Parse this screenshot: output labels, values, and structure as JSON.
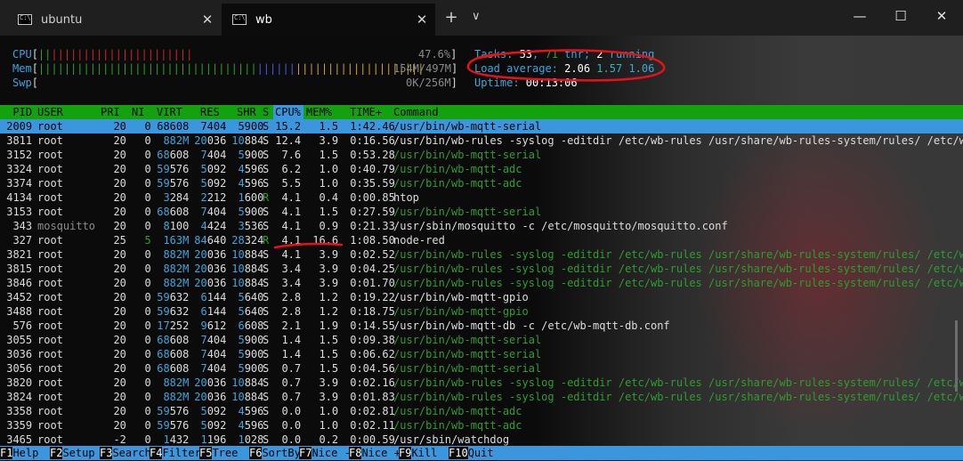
{
  "tabs": [
    {
      "label": "ubuntu",
      "active": false
    },
    {
      "label": "wb",
      "active": true
    }
  ],
  "window": {
    "new_tab": "+",
    "dropdown": "∨",
    "minimize": "—",
    "maximize": "☐",
    "close": "✕",
    "tab_close": "✕"
  },
  "meters": {
    "cpu": {
      "label": "CPU",
      "bar_green": "||",
      "bar_blue": "",
      "bar_red": "||||||||||||||||||||||",
      "bar_rest": "",
      "value": "47.6%"
    },
    "mem": {
      "label": "Mem",
      "bar_green": "||||||||||||||||||||||||||||||||||",
      "bar_blue": "||||||",
      "bar_yellow": "||||||||||||||||||||",
      "value": "154M/497M"
    },
    "swp": {
      "label": "Swp",
      "value": "0K/256M"
    }
  },
  "stats": {
    "tasks_label": "Tasks: ",
    "tasks": "53",
    "thr": "71",
    "thr_label": " thr; ",
    "running": "2",
    "running_label": " running",
    "load_label": "Load average: ",
    "load1": "2.06",
    "load5": "1.57",
    "load15": "1.06",
    "uptime_label": "Uptime: ",
    "uptime": "00:13:06"
  },
  "columns": {
    "pid": "PID",
    "user": "USER",
    "pri": "PRI",
    "ni": "NI",
    "virt": "VIRT",
    "res": "RES",
    "shr": "SHR",
    "s": "S",
    "cpu": "CPU%",
    "mem": "MEM%",
    "time": "TIME+",
    "command": "Command"
  },
  "processes": [
    {
      "pid": "2009",
      "user": "root",
      "pri": "20",
      "ni": "0",
      "virt": "68608",
      "res": "7404",
      "shr": "5900",
      "s": "S",
      "cpu": "15.2",
      "mem": "1.5",
      "time": "1:42.46",
      "cmd": "/usr/bin/wb-mqtt-serial",
      "thread": false
    },
    {
      "pid": "3811",
      "user": "root",
      "pri": "20",
      "ni": "0",
      "virt": "882M",
      "res": "20036",
      "shr": "10884",
      "s": "S",
      "cpu": "12.4",
      "mem": "3.9",
      "time": "0:16.56",
      "cmd": "/usr/bin/wb-rules -syslog -editdir /etc/wb-rules /usr/share/wb-rules-system/rules/ /etc/w",
      "thread": false
    },
    {
      "pid": "3152",
      "user": "root",
      "pri": "20",
      "ni": "0",
      "virt": "68608",
      "res": "7404",
      "shr": "5900",
      "s": "S",
      "cpu": "7.6",
      "mem": "1.5",
      "time": "0:53.28",
      "cmd": "/usr/bin/wb-mqtt-serial",
      "thread": true
    },
    {
      "pid": "3324",
      "user": "root",
      "pri": "20",
      "ni": "0",
      "virt": "59576",
      "res": "5092",
      "shr": "4596",
      "s": "S",
      "cpu": "6.2",
      "mem": "1.0",
      "time": "0:40.79",
      "cmd": "/usr/bin/wb-mqtt-adc",
      "thread": true
    },
    {
      "pid": "3374",
      "user": "root",
      "pri": "20",
      "ni": "0",
      "virt": "59576",
      "res": "5092",
      "shr": "4596",
      "s": "S",
      "cpu": "5.5",
      "mem": "1.0",
      "time": "0:35.59",
      "cmd": "/usr/bin/wb-mqtt-adc",
      "thread": true
    },
    {
      "pid": "4134",
      "user": "root",
      "pri": "20",
      "ni": "0",
      "virt": "3284",
      "res": "2212",
      "shr": "1600",
      "s": "R",
      "cpu": "4.1",
      "mem": "0.4",
      "time": "0:00.85",
      "cmd": "htop",
      "thread": false
    },
    {
      "pid": "3153",
      "user": "root",
      "pri": "20",
      "ni": "0",
      "virt": "68608",
      "res": "7404",
      "shr": "5900",
      "s": "S",
      "cpu": "4.1",
      "mem": "1.5",
      "time": "0:27.59",
      "cmd": "/usr/bin/wb-mqtt-serial",
      "thread": true
    },
    {
      "pid": "343",
      "user": "mosquitto",
      "pri": "20",
      "ni": "0",
      "virt": "8100",
      "res": "4424",
      "shr": "3536",
      "s": "S",
      "cpu": "4.1",
      "mem": "0.9",
      "time": "0:21.33",
      "cmd": "/usr/sbin/mosquitto -c /etc/mosquitto/mosquitto.conf",
      "thread": false
    },
    {
      "pid": "327",
      "user": "root",
      "pri": "25",
      "ni": "5",
      "virt": "163M",
      "res": "84640",
      "shr": "28324",
      "s": "R",
      "cpu": "4.1",
      "mem": "16.6",
      "time": "1:08.50",
      "cmd": "node-red",
      "thread": false
    },
    {
      "pid": "3821",
      "user": "root",
      "pri": "20",
      "ni": "0",
      "virt": "882M",
      "res": "20036",
      "shr": "10884",
      "s": "S",
      "cpu": "4.1",
      "mem": "3.9",
      "time": "0:02.52",
      "cmd": "/usr/bin/wb-rules -syslog -editdir /etc/wb-rules /usr/share/wb-rules-system/rules/ /etc/w",
      "thread": true
    },
    {
      "pid": "3815",
      "user": "root",
      "pri": "20",
      "ni": "0",
      "virt": "882M",
      "res": "20036",
      "shr": "10884",
      "s": "S",
      "cpu": "3.4",
      "mem": "3.9",
      "time": "0:04.25",
      "cmd": "/usr/bin/wb-rules -syslog -editdir /etc/wb-rules /usr/share/wb-rules-system/rules/ /etc/w",
      "thread": true
    },
    {
      "pid": "3846",
      "user": "root",
      "pri": "20",
      "ni": "0",
      "virt": "882M",
      "res": "20036",
      "shr": "10884",
      "s": "S",
      "cpu": "3.4",
      "mem": "3.9",
      "time": "0:01.70",
      "cmd": "/usr/bin/wb-rules -syslog -editdir /etc/wb-rules /usr/share/wb-rules-system/rules/ /etc/w",
      "thread": true
    },
    {
      "pid": "3452",
      "user": "root",
      "pri": "20",
      "ni": "0",
      "virt": "59632",
      "res": "6144",
      "shr": "5640",
      "s": "S",
      "cpu": "2.8",
      "mem": "1.2",
      "time": "0:19.22",
      "cmd": "/usr/bin/wb-mqtt-gpio",
      "thread": false
    },
    {
      "pid": "3488",
      "user": "root",
      "pri": "20",
      "ni": "0",
      "virt": "59632",
      "res": "6144",
      "shr": "5640",
      "s": "S",
      "cpu": "2.8",
      "mem": "1.2",
      "time": "0:18.75",
      "cmd": "/usr/bin/wb-mqtt-gpio",
      "thread": true
    },
    {
      "pid": "576",
      "user": "root",
      "pri": "20",
      "ni": "0",
      "virt": "17252",
      "res": "9612",
      "shr": "6608",
      "s": "S",
      "cpu": "2.1",
      "mem": "1.9",
      "time": "0:14.55",
      "cmd": "/usr/bin/wb-mqtt-db -c /etc/wb-mqtt-db.conf",
      "thread": false
    },
    {
      "pid": "3055",
      "user": "root",
      "pri": "20",
      "ni": "0",
      "virt": "68608",
      "res": "7404",
      "shr": "5900",
      "s": "S",
      "cpu": "1.4",
      "mem": "1.5",
      "time": "0:09.38",
      "cmd": "/usr/bin/wb-mqtt-serial",
      "thread": true
    },
    {
      "pid": "3036",
      "user": "root",
      "pri": "20",
      "ni": "0",
      "virt": "68608",
      "res": "7404",
      "shr": "5900",
      "s": "S",
      "cpu": "1.4",
      "mem": "1.5",
      "time": "0:06.62",
      "cmd": "/usr/bin/wb-mqtt-serial",
      "thread": true
    },
    {
      "pid": "3056",
      "user": "root",
      "pri": "20",
      "ni": "0",
      "virt": "68608",
      "res": "7404",
      "shr": "5900",
      "s": "S",
      "cpu": "0.7",
      "mem": "1.5",
      "time": "0:04.56",
      "cmd": "/usr/bin/wb-mqtt-serial",
      "thread": true
    },
    {
      "pid": "3820",
      "user": "root",
      "pri": "20",
      "ni": "0",
      "virt": "882M",
      "res": "20036",
      "shr": "10884",
      "s": "S",
      "cpu": "0.7",
      "mem": "3.9",
      "time": "0:02.16",
      "cmd": "/usr/bin/wb-rules -syslog -editdir /etc/wb-rules /usr/share/wb-rules-system/rules/ /etc/w",
      "thread": true
    },
    {
      "pid": "3824",
      "user": "root",
      "pri": "20",
      "ni": "0",
      "virt": "882M",
      "res": "20036",
      "shr": "10884",
      "s": "S",
      "cpu": "0.7",
      "mem": "3.9",
      "time": "0:01.83",
      "cmd": "/usr/bin/wb-rules -syslog -editdir /etc/wb-rules /usr/share/wb-rules-system/rules/ /etc/w",
      "thread": true
    },
    {
      "pid": "3358",
      "user": "root",
      "pri": "20",
      "ni": "0",
      "virt": "59576",
      "res": "5092",
      "shr": "4596",
      "s": "S",
      "cpu": "0.0",
      "mem": "1.0",
      "time": "0:02.81",
      "cmd": "/usr/bin/wb-mqtt-adc",
      "thread": true
    },
    {
      "pid": "3359",
      "user": "root",
      "pri": "20",
      "ni": "0",
      "virt": "59576",
      "res": "5092",
      "shr": "4596",
      "s": "S",
      "cpu": "0.0",
      "mem": "1.0",
      "time": "0:02.11",
      "cmd": "/usr/bin/wb-mqtt-adc",
      "thread": true
    },
    {
      "pid": "3465",
      "user": "root",
      "pri": "-2",
      "ni": "0",
      "virt": "1432",
      "res": "1196",
      "shr": "1028",
      "s": "S",
      "cpu": "0.0",
      "mem": "0.2",
      "time": "0:00.59",
      "cmd": "/usr/sbin/watchdog",
      "thread": false
    }
  ],
  "fkeys": [
    {
      "key": "F1",
      "label": "Help"
    },
    {
      "key": "F2",
      "label": "Setup"
    },
    {
      "key": "F3",
      "label": "Search"
    },
    {
      "key": "F4",
      "label": "Filter"
    },
    {
      "key": "F5",
      "label": "Tree"
    },
    {
      "key": "F6",
      "label": "SortBy"
    },
    {
      "key": "F7",
      "label": "Nice -"
    },
    {
      "key": "F8",
      "label": "Nice +"
    },
    {
      "key": "F9",
      "label": "Kill"
    },
    {
      "key": "F10",
      "label": "Quit"
    }
  ],
  "colors": {
    "header_bg": "#13a10e",
    "selected_bg": "#3a96dd",
    "annotation": "#e8101a"
  },
  "icons": {
    "tab_icon": "terminal-icon"
  }
}
